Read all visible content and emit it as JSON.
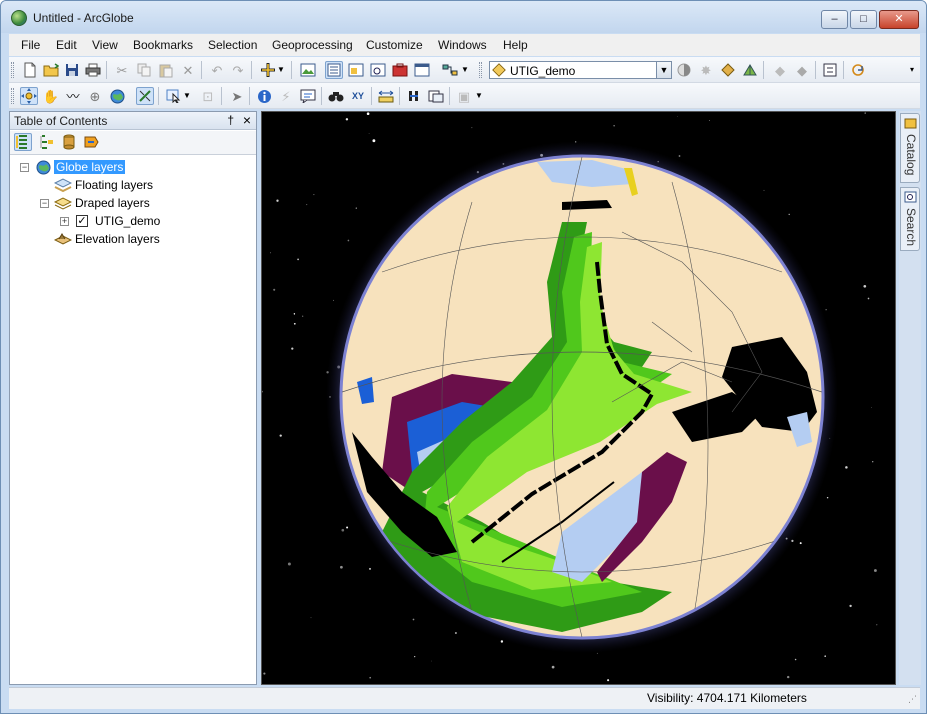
{
  "window": {
    "title": "Untitled - ArcGlobe",
    "min_label": "–",
    "max_label": "□",
    "close_label": "✕"
  },
  "menu": {
    "items": [
      "File",
      "Edit",
      "View",
      "Bookmarks",
      "Selection",
      "Geoprocessing",
      "Customize",
      "Windows",
      "Help"
    ]
  },
  "toolbar": {
    "layer_combo_value": "UTIG_demo",
    "row1_icons": [
      "new-document-icon",
      "open-folder-icon",
      "save-icon",
      "print-icon",
      "cut-icon",
      "copy-icon",
      "paste-icon",
      "delete-icon",
      "undo-icon",
      "redo-icon",
      "add-data-icon",
      "add-data-dropdown-icon",
      "globe-view-icon",
      "table-of-contents-icon",
      "catalog-window-icon",
      "search-window-icon",
      "arctoolbox-icon",
      "python-window-icon",
      "model-builder-icon",
      "layer-icon",
      "shadow-icon",
      "sun-icon",
      "swipe-icon",
      "extrude-icon",
      "transparency-icon",
      "contrast-icon",
      "full-screen-icon",
      "refresh-icon"
    ],
    "row2_icons": [
      "navigate-icon",
      "pan-icon",
      "fly-icon",
      "target-icon",
      "full-extent-icon",
      "zoom-to-layer-icon",
      "select-features-icon",
      "clear-selection-icon",
      "select-elements-icon",
      "identify-icon",
      "hyperlink-icon",
      "html-popup-icon",
      "find-icon",
      "go-to-xy-icon",
      "measure-icon",
      "time-slider-icon",
      "animation-icon",
      "viewer-icon"
    ]
  },
  "toc": {
    "title": "Table of Contents",
    "pin_label": "†",
    "close_label": "×",
    "tools": [
      "list-by-drawing-order-icon",
      "list-by-type-icon",
      "list-by-source-icon",
      "list-by-visibility-icon"
    ],
    "nodes": {
      "globe_layers": "Globe layers",
      "floating_layers": "Floating layers",
      "draped_layers": "Draped layers",
      "utig_demo": "UTIG_demo",
      "elevation_layers": "Elevation layers"
    },
    "expander_collapse": "−",
    "expander_expand": "+",
    "check_mark": "✓"
  },
  "side_tabs": {
    "catalog": "Catalog",
    "search": "Search"
  },
  "status": {
    "visibility": "Visibility:  4704.171 Kilometers",
    "grip": "⋰"
  },
  "colors": {
    "globe_land": "#f7e2bd",
    "plate_dark_green": "#2f9b16",
    "plate_mid_green": "#50c81c",
    "plate_light_green": "#8ee632",
    "plate_light_blue": "#b4cdf2",
    "plate_blue": "#1b5fd6",
    "plate_purple": "#6a0f4a",
    "ridge_black": "#000000",
    "glow": "#8a8fd8",
    "selection_blue": "#3399ff"
  }
}
